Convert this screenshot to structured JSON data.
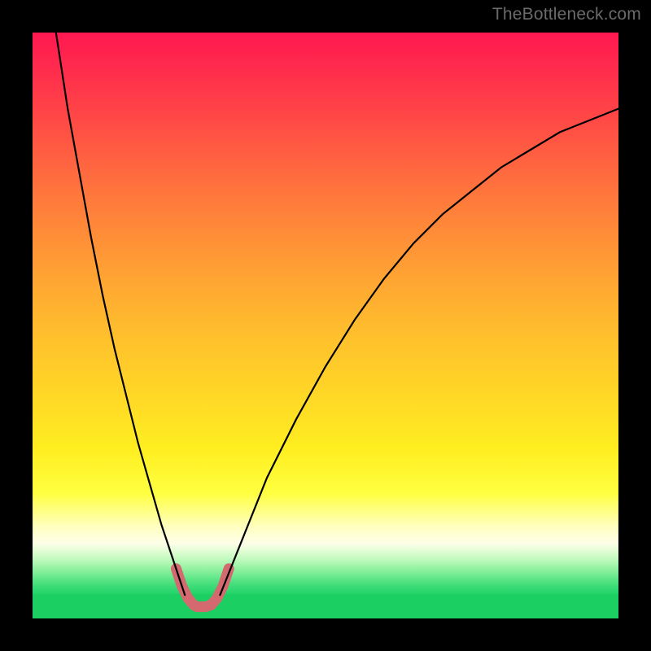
{
  "watermark": "TheBottleneck.com",
  "chart_data": {
    "type": "line",
    "title": "",
    "xlabel": "",
    "ylabel": "",
    "xlim": [
      0,
      100
    ],
    "ylim": [
      0,
      100
    ],
    "legend": false,
    "grid": false,
    "background_gradient": {
      "orientation": "vertical",
      "stops": [
        {
          "pos": 0.0,
          "color": "#ff1850"
        },
        {
          "pos": 0.25,
          "color": "#ff6a3f"
        },
        {
          "pos": 0.55,
          "color": "#ffc22c"
        },
        {
          "pos": 0.82,
          "color": "#ffff40"
        },
        {
          "pos": 0.95,
          "color": "#93f2a2"
        },
        {
          "pos": 1.0,
          "color": "#1bcf63"
        }
      ]
    },
    "series": [
      {
        "name": "left_branch",
        "color": "#000000",
        "stroke_width": 2,
        "x": [
          4,
          6,
          8,
          10,
          12,
          14,
          16,
          18,
          20,
          22,
          24,
          25,
          26
        ],
        "y": [
          100,
          87,
          76,
          65,
          55,
          46,
          38,
          30,
          23,
          16,
          10,
          7,
          4
        ]
      },
      {
        "name": "right_branch",
        "color": "#000000",
        "stroke_width": 2,
        "x": [
          32,
          34,
          36,
          40,
          45,
          50,
          55,
          60,
          65,
          70,
          75,
          80,
          85,
          90,
          95,
          100
        ],
        "y": [
          4,
          9,
          14,
          24,
          34,
          43,
          51,
          58,
          64,
          69,
          73,
          77,
          80,
          83,
          85,
          87
        ]
      },
      {
        "name": "trough_marker",
        "color": "#d46a6f",
        "stroke_width": 13,
        "linecap": "round",
        "x": [
          24.5,
          25.5,
          26.5,
          27.5,
          28.0,
          28.5,
          29.5,
          30.5,
          31.5,
          32.5,
          33.5
        ],
        "y": [
          8.5,
          5.5,
          3.5,
          2.3,
          2.0,
          2.0,
          2.0,
          2.3,
          3.5,
          5.5,
          8.5
        ]
      }
    ],
    "notes": "Axes have no visible tick labels; x and y are normalized 0–100 relative to the plotting area. y=0 is the bottom (green), y=100 is the top (red)."
  }
}
